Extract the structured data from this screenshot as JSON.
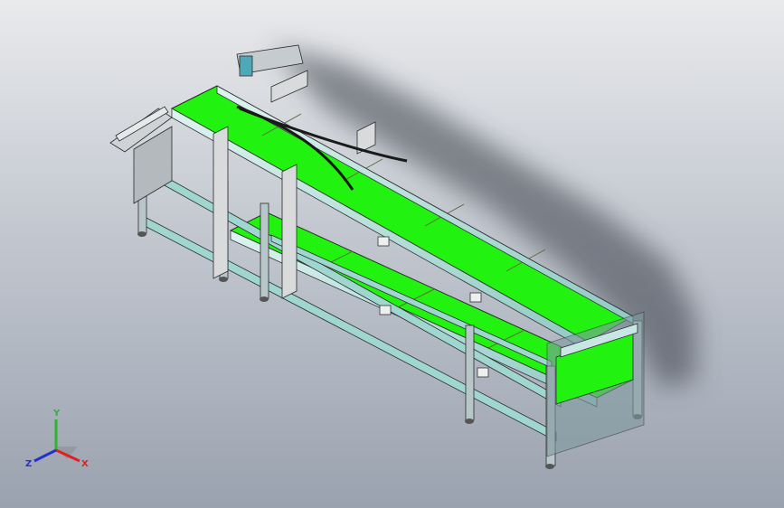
{
  "viewport": {
    "background_top": "#e9eaec",
    "background_bottom": "#9aa2af"
  },
  "model": {
    "description_icon": "conveyor-assembly",
    "pallet_color": "#22f20f",
    "frame_color": "#b9e3df",
    "cable_color": "#1a1a1a"
  },
  "triad": {
    "x_label": "X",
    "y_label": "Y",
    "z_label": "Z",
    "x_color": "#e0201c",
    "y_color": "#2db52d",
    "z_color": "#2233cc"
  }
}
